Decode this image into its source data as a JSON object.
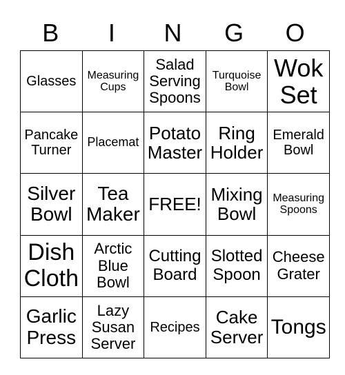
{
  "header": [
    "B",
    "I",
    "N",
    "G",
    "O"
  ],
  "cells": [
    [
      "Glasses",
      "Measuring Cups",
      "Salad Serving Spoons",
      "Turquoise Bowl",
      "Wok Set"
    ],
    [
      "Pancake Turner",
      "Placemat",
      "Potato Master",
      "Ring Holder",
      "Emerald Bowl"
    ],
    [
      "Silver Bowl",
      "Tea Maker",
      "FREE!",
      "Mixing Bowl",
      "Measuring Spoons"
    ],
    [
      "Dish Cloth",
      "Arctic Blue Bowl",
      "Cutting Board",
      "Slotted Spoon",
      "Cheese Grater"
    ],
    [
      "Garlic Press",
      "Lazy Susan Server",
      "Recipes",
      "Cake Server",
      "Tongs"
    ]
  ]
}
